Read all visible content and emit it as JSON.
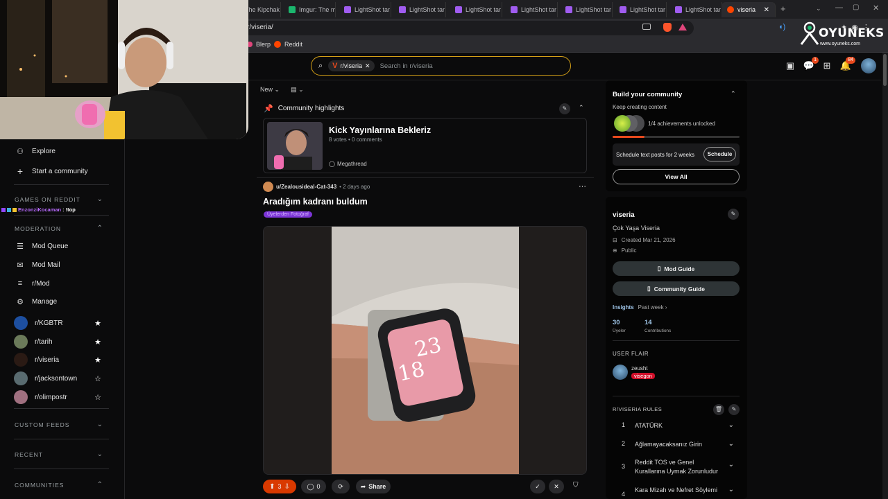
{
  "browser": {
    "tabs": [
      {
        "label": "The Kipchak",
        "color": "#888"
      },
      {
        "label": "Imgur: The m",
        "color": "#1bb76e"
      },
      {
        "label": "LightShot tar",
        "color": "#a05cf0"
      },
      {
        "label": "LightShot tar",
        "color": "#a05cf0"
      },
      {
        "label": "LightShot tar",
        "color": "#a05cf0"
      },
      {
        "label": "LightShot tar",
        "color": "#a05cf0"
      },
      {
        "label": "LightShot tar",
        "color": "#a05cf0"
      },
      {
        "label": "LightShot tar",
        "color": "#a05cf0"
      },
      {
        "label": "LightShot tar",
        "color": "#a05cf0"
      }
    ],
    "active_tab": "viseria",
    "url": "r/viseria/",
    "bookmarks": [
      "Blerp",
      "Reddit"
    ]
  },
  "overlay": {
    "brand": "OYUNEKS",
    "brand_url": "www.oyuneks.com",
    "chat_user": "EnzonziKocaman",
    "chat_msg": ": !top"
  },
  "search": {
    "chip": "r/viseria",
    "placeholder": "Search in r/viseria"
  },
  "header": {
    "chat_badge": "1",
    "notif_badge": "84"
  },
  "sidebar": {
    "explore": "Explore",
    "start": "Start a community",
    "games_head": "GAMES ON REDDIT",
    "moderation_head": "MODERATION",
    "mod_items": [
      "Mod Queue",
      "Mod Mail",
      "r/Mod",
      "Manage"
    ],
    "communities": [
      {
        "name": "r/KGBTR",
        "starred": true,
        "color": "#1d4fa0"
      },
      {
        "name": "r/tarih",
        "starred": true,
        "color": "#6b7a5a"
      },
      {
        "name": "r/viseria",
        "starred": true,
        "color": "#2a1a14"
      },
      {
        "name": "r/jacksontown",
        "starred": false,
        "color": "#596b70"
      },
      {
        "name": "r/olimpostr",
        "starred": false,
        "color": "#a07080"
      }
    ],
    "custom_feeds": "CUSTOM FEEDS",
    "recent": "RECENT",
    "communities_head": "COMMUNITIES"
  },
  "feed": {
    "sort": "New",
    "highlights_title": "Community highlights",
    "highlight": {
      "title": "Kick Yayınlarına Bekleriz",
      "meta": "8 votes • 0 comments",
      "tag": "Megathread"
    },
    "post": {
      "author": "u/Zealousideal-Cat-343",
      "time": "• 2 days ago",
      "title": "Aradığım kadranı buldum",
      "flair": "Üyelerden Fotoğraf",
      "watch_time_h": "23",
      "watch_time_m": "18",
      "votes": "3",
      "comments": "0",
      "share": "Share"
    }
  },
  "build": {
    "title": "Build your community",
    "subtitle": "Keep creating content",
    "achievements": "1/4 achievements unlocked",
    "progress": 0.25,
    "schedule_text": "Schedule text posts for 2 weeks",
    "schedule_btn": "Schedule",
    "view_all": "View All"
  },
  "about": {
    "name": "viseria",
    "desc": "Çok Yaşa Viseria",
    "created": "Created Mar 21, 2026",
    "visibility": "Public",
    "mod_guide": "Mod Guide",
    "community_guide": "Community Guide",
    "insights": "Insights",
    "period": "Past week",
    "members": "30",
    "members_label": "Üyeler",
    "contrib": "14",
    "contrib_label": "Contributions",
    "user_flair_head": "USER FLAIR",
    "flair_user": "zeusht",
    "flair_tag": "visegon",
    "rules_head": "R/VISERIA RULES",
    "rules": [
      {
        "n": "1",
        "text": "ATATÜRK"
      },
      {
        "n": "2",
        "text": "Ağlamayacaksanız Girin"
      },
      {
        "n": "3",
        "text": "Reddit TOS ve Genel Kurallarına Uymak Zorunludur"
      },
      {
        "n": "4",
        "text": "Kara Mizah ve Nefret Söylemi"
      }
    ]
  }
}
